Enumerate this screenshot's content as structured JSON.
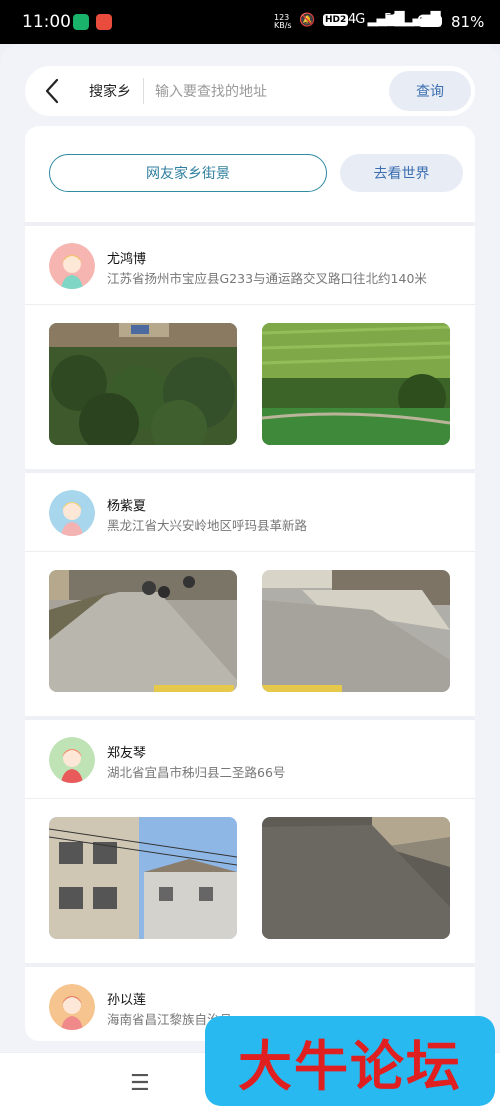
{
  "status_bar": {
    "time": "11:00",
    "net_speed": "123\nKB/s",
    "hd": "HD2",
    "signal1": "4G ▂▄▆█",
    "signal2": "5G ▂▄▆█",
    "battery_text": "81%",
    "battery_level": 0.81
  },
  "search": {
    "label": "搜家乡",
    "placeholder": "输入要查找的地址",
    "value": "",
    "button": "查询"
  },
  "tabs": {
    "primary": "网友家乡街景",
    "secondary": "去看世界"
  },
  "entries": [
    {
      "name": "尤鸿博",
      "address": "江苏省扬州市宝应县G233与通运路交叉路口往北约140米",
      "avatar_color": "#f6b5b0",
      "photos": [
        "rural-field-photo",
        "rice-paddy-photo"
      ]
    },
    {
      "name": "杨紫夏",
      "address": "黑龙江省大兴安岭地区呼玛县革新路",
      "avatar_color": "#a8d6ec",
      "photos": [
        "village-road-motorbikes-photo",
        "village-road-photo"
      ]
    },
    {
      "name": "郑友琴",
      "address": "湖北省宜昌市秭归县二圣路66号",
      "avatar_color": "#bfe3b4",
      "photos": [
        "town-buildings-photo",
        "concrete-road-photo"
      ]
    },
    {
      "name": "孙以莲",
      "address": "海南省昌江黎族自治县",
      "avatar_color": "#f6c58f",
      "photos": []
    }
  ],
  "bottom_bar": {
    "menu_icon": "☰"
  },
  "watermark": "大牛论坛"
}
